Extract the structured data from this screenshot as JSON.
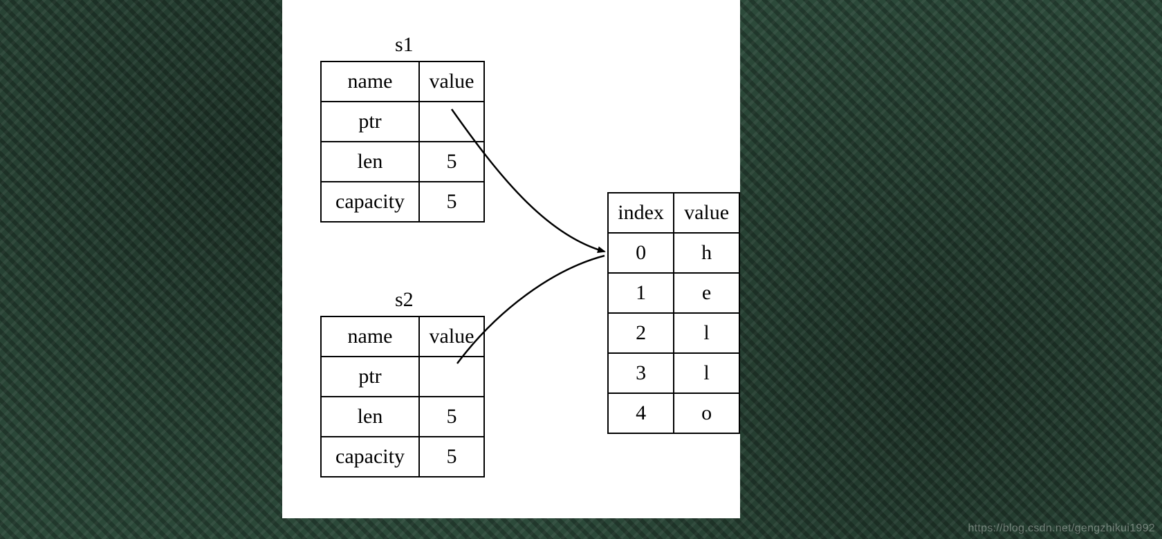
{
  "s1": {
    "title": "s1",
    "headers": {
      "name": "name",
      "value": "value"
    },
    "rows": [
      {
        "name": "ptr",
        "value": ""
      },
      {
        "name": "len",
        "value": "5"
      },
      {
        "name": "capacity",
        "value": "5"
      }
    ]
  },
  "s2": {
    "title": "s2",
    "headers": {
      "name": "name",
      "value": "value"
    },
    "rows": [
      {
        "name": "ptr",
        "value": ""
      },
      {
        "name": "len",
        "value": "5"
      },
      {
        "name": "capacity",
        "value": "5"
      }
    ]
  },
  "heap": {
    "headers": {
      "index": "index",
      "value": "value"
    },
    "rows": [
      {
        "index": "0",
        "value": "h"
      },
      {
        "index": "1",
        "value": "e"
      },
      {
        "index": "2",
        "value": "l"
      },
      {
        "index": "3",
        "value": "l"
      },
      {
        "index": "4",
        "value": "o"
      }
    ]
  },
  "watermark": "https://blog.csdn.net/gengzhikui1992"
}
